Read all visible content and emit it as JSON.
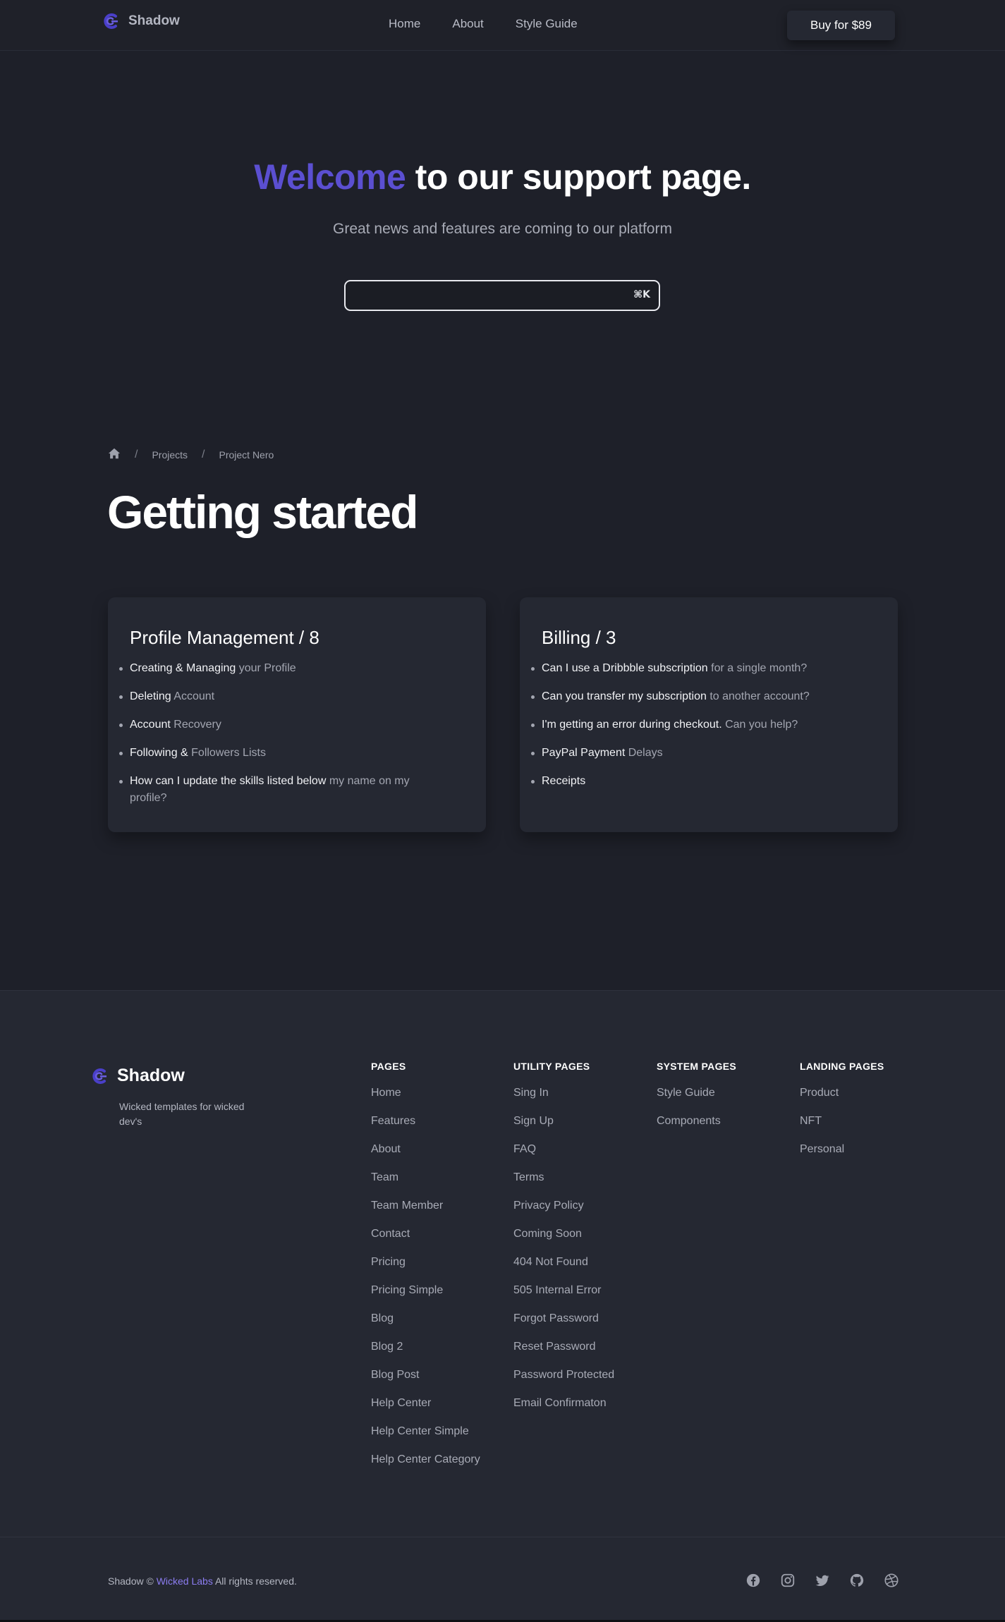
{
  "header": {
    "brand": "Shadow",
    "nav": [
      "Home",
      "About",
      "Style Guide"
    ],
    "cta": "Buy for $89"
  },
  "hero": {
    "title_accent": "Welcome",
    "title_rest": " to our support page.",
    "subtitle": "Great news and features are coming to our platform",
    "search": {
      "value": "",
      "shortcut": "⌘K"
    }
  },
  "breadcrumb": {
    "items": [
      "Projects",
      "Project Nero"
    ]
  },
  "page_title": "Getting started",
  "cards": [
    {
      "title": "Profile Management / 8",
      "items": [
        {
          "strong": "Creating & Managing",
          "rest": " your Profile"
        },
        {
          "strong": "Deleting",
          "rest": " Account"
        },
        {
          "strong": "Account",
          "rest": " Recovery"
        },
        {
          "strong": "Following &",
          "rest": " Followers Lists"
        },
        {
          "strong": "How can I update the skills listed below",
          "rest": " my name on my profile?"
        }
      ]
    },
    {
      "title": "Billing / 3",
      "items": [
        {
          "strong": "Can I use a Dribbble subscription",
          "rest": " for a single month?"
        },
        {
          "strong": "Can you transfer my subscription",
          "rest": " to another account?"
        },
        {
          "strong": "I'm getting an error during checkout.",
          "rest": " Can you help?"
        },
        {
          "strong": "PayPal Payment",
          "rest": " Delays"
        },
        {
          "strong": "Receipts",
          "rest": ""
        }
      ]
    }
  ],
  "footer": {
    "brand": "Shadow",
    "tagline": "Wicked templates for wicked dev's",
    "columns": [
      {
        "heading": "PAGES",
        "links": [
          "Home",
          "Features",
          "About",
          "Team",
          "Team Member",
          "Contact",
          "Pricing",
          "Pricing Simple",
          "Blog",
          "Blog 2",
          "Blog Post",
          "Help Center",
          "Help Center Simple",
          "Help Center Category"
        ]
      },
      {
        "heading": "UTILITY PAGES",
        "links": [
          "Sing In",
          "Sign Up",
          "FAQ",
          "Terms",
          "Privacy Policy",
          "Coming Soon",
          "404 Not Found",
          "505 Internal Error",
          "Forgot Password",
          "Reset Password",
          "Password Protected",
          "Email Confirmaton"
        ]
      },
      {
        "heading": "SYSTEM PAGES",
        "links": [
          "Style Guide",
          "Components"
        ]
      },
      {
        "heading": "LANDING PAGES",
        "links": [
          "Product",
          "NFT",
          "Personal"
        ]
      }
    ],
    "copyright_pre": "Shadow © ",
    "copyright_link": "Wicked Labs",
    "copyright_post": " All rights reserved.",
    "socials": [
      "facebook-icon",
      "instagram-icon",
      "twitter-icon",
      "github-icon",
      "dribbble-icon"
    ]
  },
  "colors": {
    "accent": "#5b4fd1",
    "background": "#1e2029",
    "card": "#252832"
  }
}
